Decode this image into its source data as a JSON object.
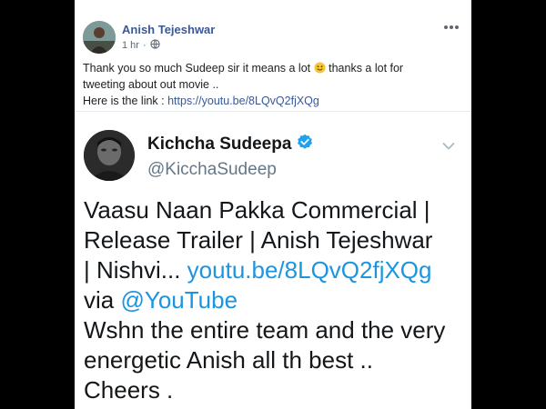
{
  "post": {
    "author": "Anish Tejeshwar",
    "timestamp": "1 hr",
    "privacy_icon": "globe-icon",
    "more_icon": "more-dots-icon",
    "text_line1_a": "Thank you so much Sudeep sir it means a lot",
    "text_line1_b": "thanks a lot for",
    "text_line2": "tweeting about out movie ..",
    "text_line3_prefix": "Here is the link : ",
    "text_line3_link": "https://youtu.be/8LQvQ2fjXQg",
    "emoji_icon": "smiley-emoji-icon"
  },
  "tweet": {
    "display_name": "Kichcha Sudeepa",
    "handle": "@KicchaSudeep",
    "verified_icon": "verified-badge-icon",
    "chevron_icon": "chevron-down-icon",
    "line1": "Vaasu Naan Pakka Commercial |",
    "line2": "Release Trailer | Anish Tejeshwar",
    "line3_prefix": "| Nishvi... ",
    "line3_link": "youtu.be/8LQvQ2fjXQg",
    "line4_prefix": "via ",
    "line4_link": "@YouTube",
    "line5": "Wshn the entire team and the very",
    "line6": "energetic Anish all th best ..",
    "line7": "Cheers ."
  },
  "colors": {
    "background": "#000000",
    "card": "#ffffff",
    "fb_link": "#385898",
    "tw_link": "#1b95e0",
    "verified": "#1da1f2"
  }
}
